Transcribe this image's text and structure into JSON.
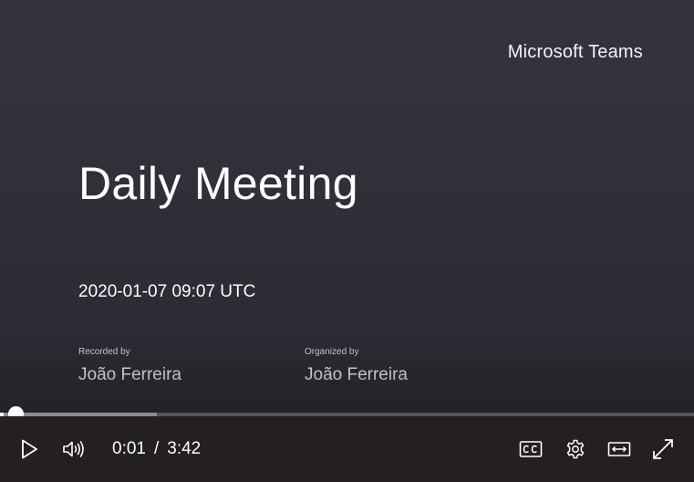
{
  "slide": {
    "brand": "Microsoft Teams",
    "title": "Daily Meeting",
    "datetime": "2020-01-07 09:07 UTC",
    "recorded_by_label": "Recorded by",
    "recorded_by": "João Ferreira",
    "organized_by_label": "Organized by",
    "organized_by": "João Ferreira"
  },
  "player": {
    "current_time": "0:01",
    "separator": "/",
    "duration": "3:42",
    "played_fraction": 0.005,
    "buffered_fraction": 0.226
  },
  "controls": {
    "play_icon": "play-icon",
    "volume_icon": "volume-icon",
    "captions_icon": "closed-captions-icon",
    "settings_icon": "gear-icon",
    "theater_icon": "theater-mode-icon",
    "fullscreen_icon": "fullscreen-icon"
  },
  "colors": {
    "background": "#2f2e37",
    "control_bar": "#241f22",
    "text": "#ffffff",
    "progress_track": "#57555c",
    "progress_buffer": "#8d8b91"
  }
}
